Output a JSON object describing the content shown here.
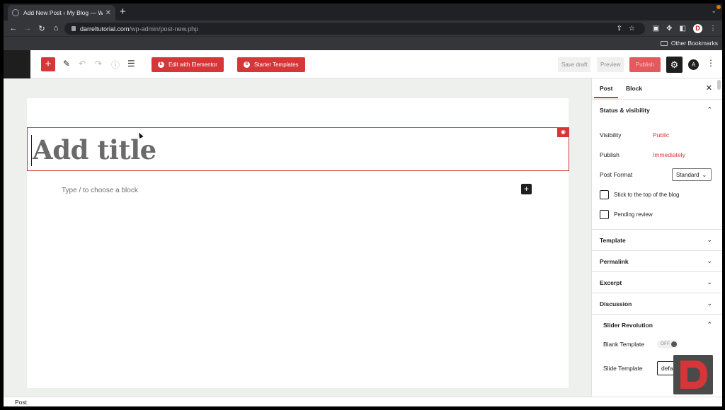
{
  "browser": {
    "tab_title": "Add New Post ‹ My Blog — Wo",
    "tab_close": "✕",
    "new_tab": "+",
    "url_domain": "darreltutorial.com",
    "url_path": "/wp-admin/post-new.php",
    "profile_letter": "D",
    "other_bookmarks": "Other Bookmarks"
  },
  "wp_toolbar": {
    "inserter": "+",
    "edit_elementor": "Edit with Elementor",
    "starter_templates": "Starter Templates",
    "save_draft": "Save draft",
    "preview": "Preview",
    "publish": "Publish"
  },
  "editor": {
    "title_placeholder": "Add title",
    "block_placeholder": "Type / to choose a block",
    "block_add": "+"
  },
  "sidebar": {
    "tab_post": "Post",
    "tab_block": "Block",
    "close": "✕",
    "status_visibility": "Status & visibility",
    "visibility_label": "Visibility",
    "visibility_value": "Public",
    "publish_label": "Publish",
    "publish_value": "Immediately",
    "post_format_label": "Post Format",
    "post_format_value": "Standard",
    "stick_top": "Stick to the top of the blog",
    "pending_review": "Pending review",
    "panels": [
      "Template",
      "Permalink",
      "Excerpt",
      "Discussion"
    ],
    "slider_revolution": "Slider Revolution",
    "blank_template_label": "Blank Template",
    "blank_template_toggle": "OFF",
    "slide_template_label": "Slide Template",
    "slide_template_value": "default"
  },
  "footer": {
    "breadcrumb": "Post"
  },
  "colors": {
    "accent": "#d63638",
    "chrome_dark": "#202124"
  }
}
